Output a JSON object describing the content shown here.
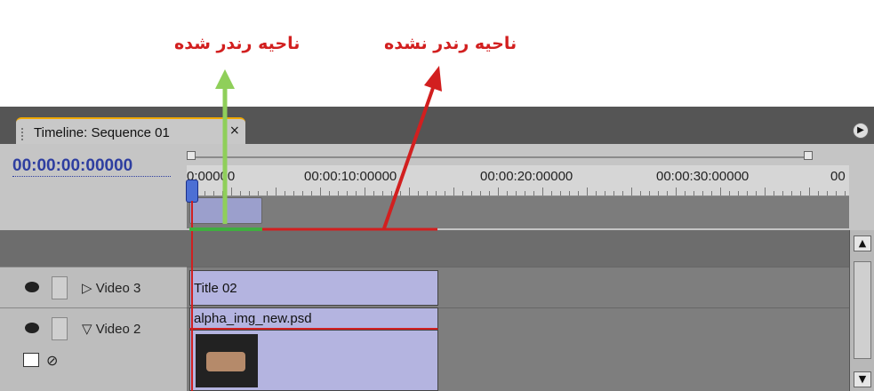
{
  "annotations": {
    "rendered_label": "ناحیه رندر شده",
    "unrendered_label": "ناحیه رندر نشده",
    "rendered_color": "#8fcf5a",
    "unrendered_color": "#d21f1f"
  },
  "panel": {
    "tab_title": "Timeline: Sequence 01",
    "tab_close_icon": "×",
    "panel_menu_icon": "▶",
    "accent_color": "#f0a800"
  },
  "timecode": "00:00:00:00000",
  "ruler": {
    "labels": [
      "0:00000",
      "00:00:10:00000",
      "00:00:20:00000",
      "00:00:30:00000",
      "00"
    ]
  },
  "toolbar": {
    "icons": [
      "snap-icon",
      "set-marker-icon",
      "set-encore-marker-icon",
      "keyframe-nav-icon"
    ]
  },
  "tracks": [
    {
      "name": "Video 3",
      "expand_icon": "▷",
      "clip": "Title 02"
    },
    {
      "name": "Video 2",
      "expand_icon": "▽",
      "clip": "alpha_img_new.psd"
    }
  ],
  "scrollbar": {
    "up_icon": "▲",
    "down_icon": "▼"
  }
}
